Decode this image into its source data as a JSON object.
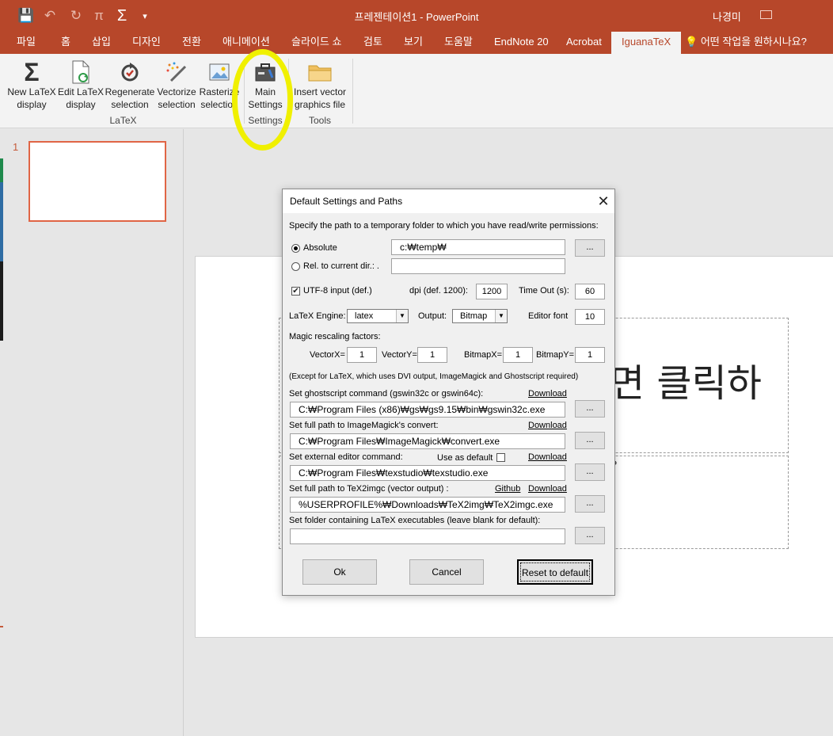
{
  "window": {
    "title": "프레젠테이션1  -  PowerPoint",
    "user": "나경미"
  },
  "quick_access": {
    "save_icon": "💾",
    "undo_icon": "↶",
    "redo_icon": "↻",
    "pi_icon": "π",
    "sigma_icon": "Σ",
    "more_icon": "▾"
  },
  "tabs": [
    "파일",
    "홈",
    "삽입",
    "디자인",
    "전환",
    "애니메이션",
    "슬라이드 쇼",
    "검토",
    "보기",
    "도움말",
    "EndNote 20",
    "Acrobat",
    "IguanaTeX"
  ],
  "active_tab": "IguanaTeX",
  "tell_me": "어떤 작업을 원하시나요?",
  "ribbon": {
    "buttons": [
      {
        "line1": "New LaTeX",
        "line2": "display"
      },
      {
        "line1": "Edit LaTeX",
        "line2": "display"
      },
      {
        "line1": "Regenerate",
        "line2": "selection"
      },
      {
        "line1": "Vectorize",
        "line2": "selection"
      },
      {
        "line1": "Rasterize",
        "line2": "selection"
      },
      {
        "line1": "Main",
        "line2": "Settings"
      },
      {
        "line1": "Insert vector",
        "line2": "graphics file"
      }
    ],
    "groups": [
      "LaTeX",
      "Settings",
      "Tools"
    ]
  },
  "slides_pane": {
    "slide_number": "1"
  },
  "slide": {
    "title_text": "면 클릭하",
    "subtitle_text": "P"
  },
  "dialog": {
    "title": "Default Settings and Paths",
    "temp_label": "Specify the path to a temporary folder to which you have read/write permissions:",
    "absolute_label": "Absolute",
    "absolute_value": "c:₩temp₩",
    "relative_label": "Rel. to current dir.: .",
    "relative_value": "",
    "browse": "...",
    "utf8_label": "UTF-8 input (def.)",
    "utf8_checked": true,
    "dpi_label": "dpi (def. 1200):",
    "dpi_value": "1200",
    "timeout_label": "Time Out (s):",
    "timeout_value": "60",
    "engine_label": "LaTeX Engine:",
    "engine_value": "latex",
    "output_label": "Output:",
    "output_value": "Bitmap",
    "editor_font_label": "Editor font",
    "editor_font_value": "10",
    "magic_label": "Magic rescaling factors:",
    "vectorx_label": "VectorX=",
    "vectorx_value": "1",
    "vectory_label": "VectorY=",
    "vectory_value": "1",
    "bitmapx_label": "BitmapX=",
    "bitmapx_value": "1",
    "bitmapy_label": "BitmapY=",
    "bitmapy_value": "1",
    "except_note": "(Except for LaTeX, which uses DVI output, ImageMagick and Ghostscript required)",
    "gs_label": "Set ghostscript command (gswin32c or gswin64c):",
    "gs_value": "C:₩Program Files (x86)₩gs₩gs9.15₩bin₩gswin32c.exe",
    "im_label": "Set full path to ImageMagick's convert:",
    "im_value": "C:₩Program Files₩ImageMagick₩convert.exe",
    "editor_label": "Set external editor command:",
    "use_default_label": "Use as default",
    "editor_value": "C:₩Program Files₩texstudio₩texstudio.exe",
    "tex2img_label": "Set full path to TeX2imgc (vector output) :",
    "tex2img_value": "%USERPROFILE%₩Downloads₩TeX2img₩TeX2imgc.exe",
    "latex_folder_label": "Set folder containing LaTeX executables (leave blank for default):",
    "latex_folder_value": "",
    "download": "Download",
    "github": "Github",
    "ok": "Ok",
    "cancel": "Cancel",
    "reset": "Reset to default"
  },
  "colors": {
    "ppt_accent": "#b7472a",
    "highlight": "#f0f000",
    "thumb_border": "#e06545"
  }
}
